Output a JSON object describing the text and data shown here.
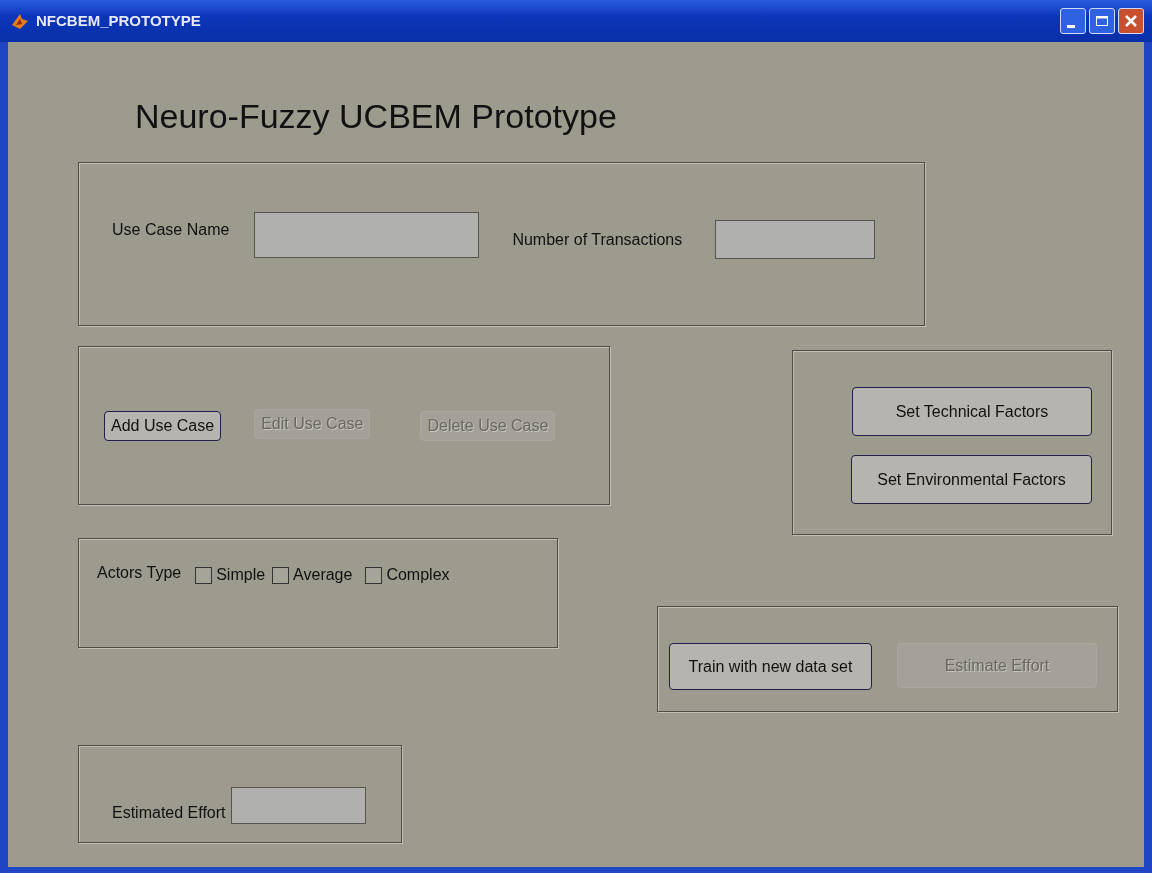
{
  "window": {
    "title": "NFCBEM_PROTOTYPE"
  },
  "heading": "Neuro-Fuzzy UCBEM Prototype",
  "use_case_fields": [
    {
      "label": "Use Case Name"
    },
    {
      "label": "Number of Transactions"
    }
  ],
  "use_case_buttons": [
    {
      "label": "Add Use Case",
      "disabled": false
    },
    {
      "label": "Edit Use Case",
      "disabled": true
    },
    {
      "label": "Delete Use Case",
      "disabled": true
    }
  ],
  "factor_buttons": [
    {
      "label": "Set Technical Factors",
      "disabled": false
    },
    {
      "label": "Set Environmental Factors",
      "disabled": false
    }
  ],
  "actors": {
    "label": "Actors Type",
    "options": [
      {
        "label": "Simple",
        "checked": false
      },
      {
        "label": "Average",
        "checked": false
      },
      {
        "label": "Complex",
        "checked": false
      }
    ]
  },
  "training_buttons": [
    {
      "label": "Train with new data set",
      "disabled": false
    },
    {
      "label": "Estimate Effort",
      "disabled": true
    }
  ],
  "estimate": {
    "label": "Estimated Effort"
  }
}
